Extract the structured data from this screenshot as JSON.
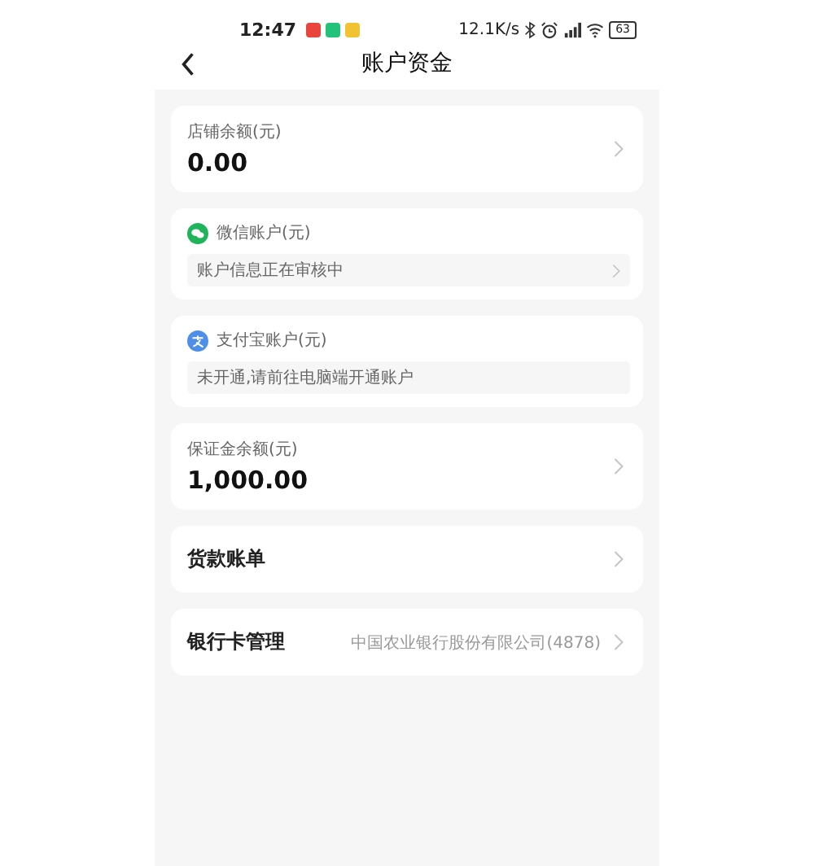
{
  "status_bar": {
    "time": "12:47",
    "network_speed": "12.1K/s",
    "battery": "63"
  },
  "header": {
    "title": "账户资金"
  },
  "cards": [
    {
      "kind": "balance",
      "label": "店铺余额(元)",
      "value": "0.00"
    },
    {
      "kind": "account",
      "label": "微信账户(元)",
      "status": "账户信息正在审核中",
      "chevron": true
    },
    {
      "kind": "account",
      "label": "支付宝账户(元)",
      "status": "未开通,请前往电脑端开通账户",
      "chevron": false
    },
    {
      "kind": "balance",
      "label": "保证金余额(元)",
      "value": "1,000.00"
    },
    {
      "kind": "link",
      "label": "货款账单"
    },
    {
      "kind": "link",
      "label": "银行卡管理",
      "detail": "中国农业银行股份有限公司(4878)"
    }
  ]
}
